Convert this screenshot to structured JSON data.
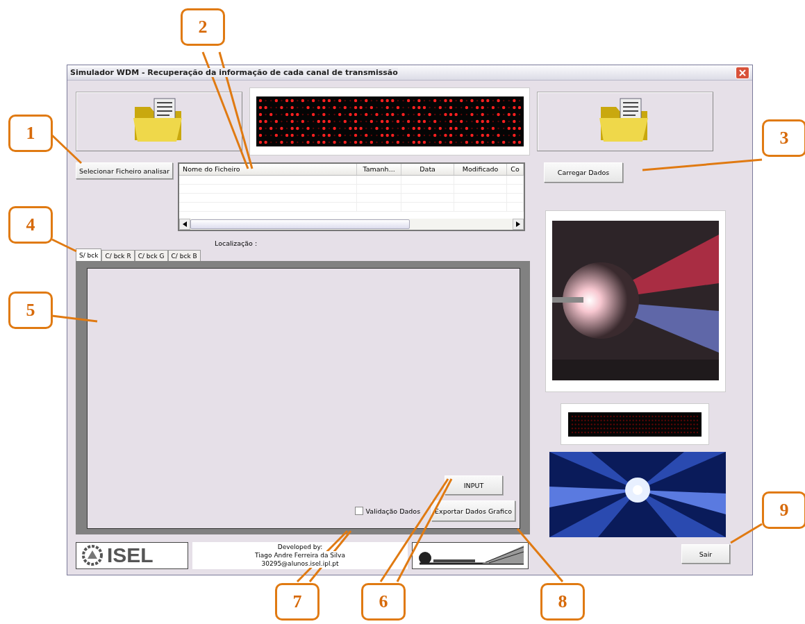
{
  "window": {
    "title": "Simulador WDM - Recuperação da informação de cada canal de transmissão"
  },
  "select_button": "Selecionar Ficheiro analisar",
  "file_list": {
    "columns": [
      "Nome do Ficheiro",
      "Tamanh...",
      "Data",
      "Modificado",
      "Co"
    ]
  },
  "load_button": "Carregar Dados",
  "location_label": "Localização :",
  "tabs": [
    {
      "label": "S/ bck",
      "selected": true
    },
    {
      "label": "C/ bck  R",
      "selected": false
    },
    {
      "label": "C/ bck G",
      "selected": false
    },
    {
      "label": "C/ bck B",
      "selected": false
    }
  ],
  "input_button": "INPUT",
  "validation": {
    "label": "Validação Dados",
    "checked": false
  },
  "export_button": "Exportar Dados Grafico",
  "footer": {
    "logo": "ISEL",
    "credits": [
      "Developed by:",
      "Tiago Andre Ferreira da Silva",
      "30295@alunos.isel.ipl.pt"
    ]
  },
  "exit_button": "Sair",
  "callouts": [
    "1",
    "2",
    "3",
    "4",
    "5",
    "7",
    "6",
    "8",
    "9"
  ]
}
